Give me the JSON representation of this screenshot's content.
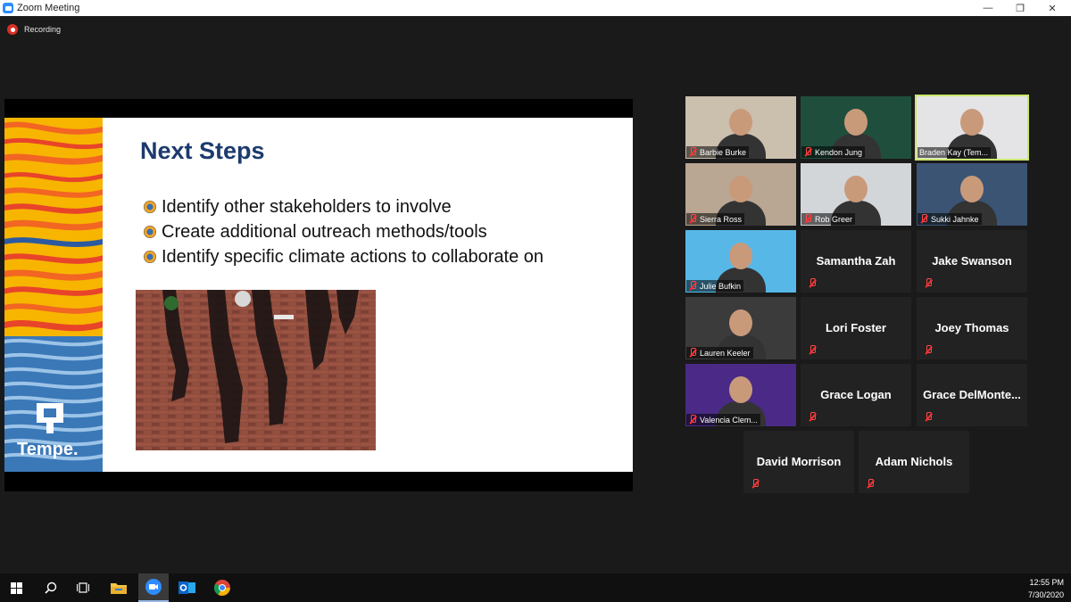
{
  "window": {
    "title": "Zoom Meeting",
    "minimize": "—",
    "restore": "❐",
    "close": "✕"
  },
  "recording": {
    "label": "Recording"
  },
  "slide": {
    "title": "Next Steps",
    "bullets": [
      "Identify other stakeholders to involve",
      "Create additional outreach methods/tools",
      "Identify specific climate actions to collaborate on"
    ],
    "logo_text": "Tempe."
  },
  "participants": [
    {
      "name": "Barbie Burke",
      "video": true
    },
    {
      "name": "Kendon Jung",
      "video": true
    },
    {
      "name": "Braden Kay (Tem...",
      "video": true,
      "active": true
    },
    {
      "name": "Sierra Ross",
      "video": true
    },
    {
      "name": "Rob Greer",
      "video": true
    },
    {
      "name": "Sukki Jahnke",
      "video": true
    },
    {
      "name": "Julie Bufkin",
      "video": true
    },
    {
      "name": "Samantha Zah",
      "video": false
    },
    {
      "name": "Jake Swanson",
      "video": false
    },
    {
      "name": "Lauren Keeler",
      "video": true
    },
    {
      "name": "Lori Foster",
      "video": false
    },
    {
      "name": "Joey Thomas",
      "video": false
    },
    {
      "name": "Valencia Clem...",
      "video": true
    },
    {
      "name": "Grace Logan",
      "video": false
    },
    {
      "name": "Grace  DelMonte...",
      "video": false
    },
    {
      "name": "David Morrison",
      "video": false
    },
    {
      "name": "Adam Nichols",
      "video": false
    }
  ],
  "taskbar": {
    "time": "12:55 PM",
    "date": "7/30/2020"
  },
  "colors": {
    "active_speaker": "#c9e86a",
    "title_blue": "#1c3a6e",
    "mic_muted": "#ff3030"
  }
}
